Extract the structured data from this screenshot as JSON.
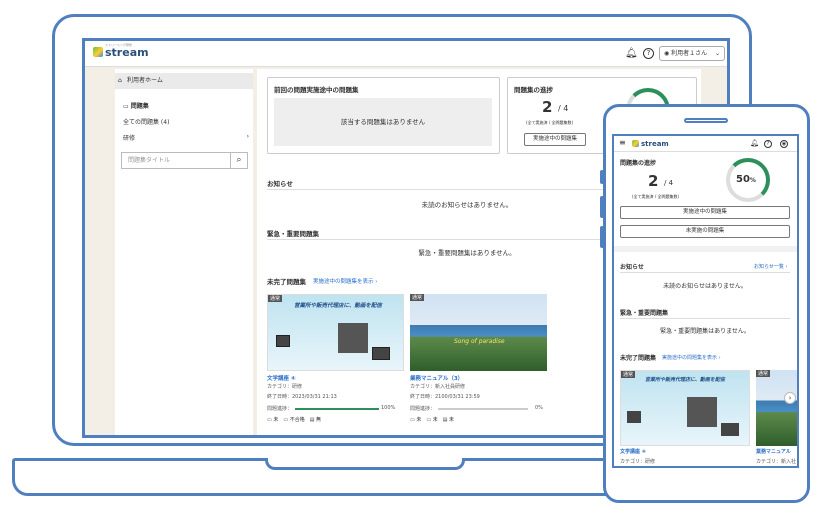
{
  "desktop": {
    "logo": "stream",
    "logo_tagline": "ストリーミング研修",
    "user_label": "利用者１さん",
    "sidebar": {
      "home": "利用者ホーム",
      "section": "問題集",
      "all": "全ての問題集 (4)",
      "category": "研修",
      "search_placeholder": "問題集タイトル"
    },
    "last_card": {
      "title": "前回の問題実施途中の問題集",
      "empty": "該当する問題集はありません"
    },
    "progress_card": {
      "title": "問題集の進捗",
      "done": "2",
      "total": "/ 4",
      "caption": "(全て実施済 / 全問題集数)",
      "button": "実施途中の問題集"
    },
    "notices": {
      "title": "お知らせ",
      "empty": "未読のお知らせはありません。"
    },
    "urgent": {
      "title": "緊急・重要問題集",
      "empty": "緊急・重要問題集はありません。"
    },
    "incomplete": {
      "title": "未完了問題集",
      "link": "実施途中の問題集を表示 ›"
    },
    "items": [
      {
        "tag": "通常",
        "banner": "営業所や販売代理店に、動画を配信",
        "name": "文学講座",
        "badge": "④",
        "category": "カテゴリ：研修",
        "deadline": "終了日時：2023/03/31 21:13",
        "progress_label": "問題進捗：",
        "progress": "100%",
        "progress_value": 1.0,
        "status1": "未",
        "status2": "不合格",
        "status3": "無"
      },
      {
        "tag": "通常",
        "banner": "Song of paradise",
        "name": "業務マニュアル（3）",
        "badge": "",
        "category": "カテゴリ：新入社員研修",
        "deadline": "終了日時：2100/03/31 23:59",
        "progress_label": "問題進捗：",
        "progress": "0%",
        "progress_value": 0.0,
        "status1": "未",
        "status2": "未",
        "status3": "未"
      }
    ]
  },
  "mobile": {
    "logo": "stream",
    "progress": {
      "title": "問題集の進捗",
      "done": "2",
      "total": "/ 4",
      "caption": "(全て実施済 / 全問題集数)",
      "percent": "50",
      "percent_unit": "%",
      "percent_value": 0.5,
      "btn1": "実施途中の問題集",
      "btn2": "未実施の問題集"
    },
    "notices": {
      "title": "お知らせ",
      "link": "お知らせ一覧 ›",
      "empty": "未読のお知らせはありません。"
    },
    "urgent": {
      "title": "緊急・重要問題集",
      "empty": "緊急・重要問題集はありません。"
    },
    "incomplete": {
      "title": "未完了問題集",
      "link": "実施途中の問題集を表示 ›"
    },
    "item1": {
      "tag": "通常",
      "banner": "営業所や販売代理店に、動画を配信",
      "name": "文学講座",
      "badge": "④",
      "category": "カテゴリ：研修"
    },
    "item2": {
      "tag": "通常",
      "name": "業務マニュアル",
      "category": "カテゴリ：新入社"
    }
  },
  "colors": {
    "frame": "#4f7fbf",
    "accent": "#2a6fc9",
    "progress": "#2d8f5a"
  }
}
